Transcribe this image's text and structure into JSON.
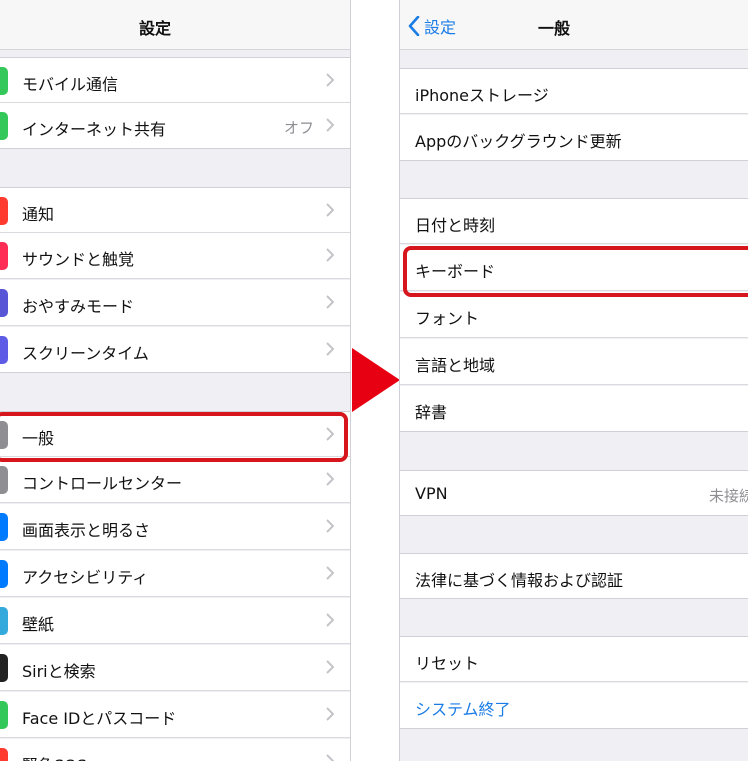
{
  "left": {
    "title": "設定",
    "rows": [
      {
        "label": "モバイル通信",
        "color": "#34c759"
      },
      {
        "label": "インターネット共有",
        "value": "オフ",
        "color": "#34c759"
      },
      {
        "label": "通知",
        "color": "#ff3b30"
      },
      {
        "label": "サウンドと触覚",
        "color": "#ff2d55"
      },
      {
        "label": "おやすみモード",
        "color": "#5856d6"
      },
      {
        "label": "スクリーンタイム",
        "color": "#5e5ce6"
      },
      {
        "label": "一般",
        "color": "#8e8e93"
      },
      {
        "label": "コントロールセンター",
        "color": "#8e8e93"
      },
      {
        "label": "画面表示と明るさ",
        "color": "#007aff"
      },
      {
        "label": "アクセシビリティ",
        "color": "#007aff"
      },
      {
        "label": "壁紙",
        "color": "#34aadc"
      },
      {
        "label": "Siriと検索",
        "color": "#222222"
      },
      {
        "label": "Face IDとパスコード",
        "color": "#34c759"
      },
      {
        "label": "緊急SOS",
        "color": "#ff3b30"
      }
    ]
  },
  "right": {
    "back_label": "設定",
    "title": "一般",
    "rows": [
      {
        "label": "iPhoneストレージ"
      },
      {
        "label": "Appのバックグラウンド更新"
      },
      {
        "label": "日付と時刻"
      },
      {
        "label": "キーボード"
      },
      {
        "label": "フォント"
      },
      {
        "label": "言語と地域"
      },
      {
        "label": "辞書"
      },
      {
        "label": "VPN",
        "value": "未接続"
      },
      {
        "label": "法律に基づく情報および認証"
      },
      {
        "label": "リセット"
      },
      {
        "label": "システム終了",
        "accent": "#1a7ce6"
      }
    ]
  },
  "colors": {
    "highlight": "#d6151d",
    "accent": "#1a7ce6"
  }
}
